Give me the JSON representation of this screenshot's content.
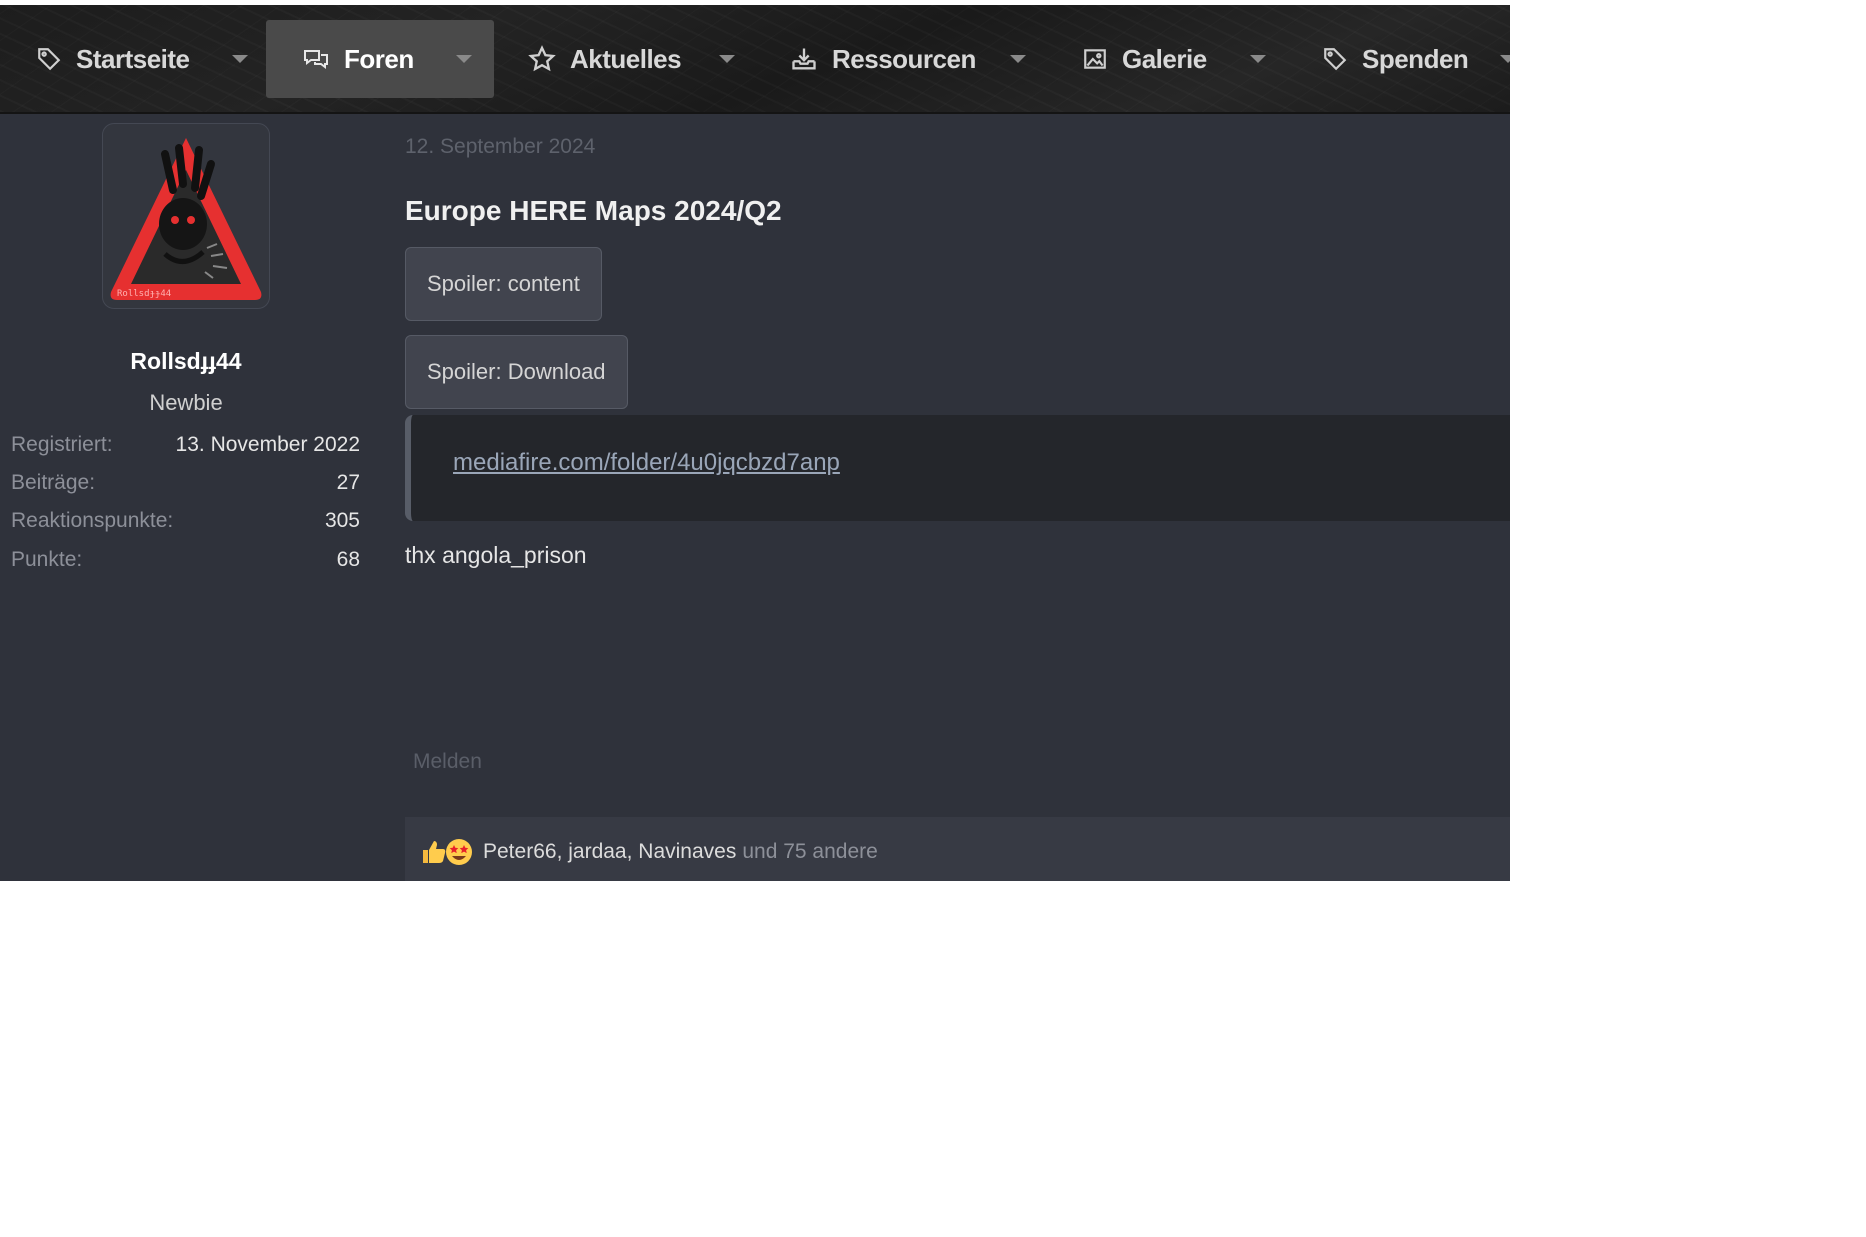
{
  "nav": {
    "items": [
      {
        "label": "Startseite",
        "icon": "tag-icon",
        "active": false
      },
      {
        "label": "Foren",
        "icon": "chat-bubbles-icon",
        "active": true
      },
      {
        "label": "Aktuelles",
        "icon": "star-icon",
        "active": false
      },
      {
        "label": "Ressourcen",
        "icon": "download-tray-icon",
        "active": false
      },
      {
        "label": "Galerie",
        "icon": "image-icon",
        "active": false
      },
      {
        "label": "Spenden",
        "icon": "tag-icon",
        "active": false
      }
    ]
  },
  "user": {
    "avatar_text": "Rollsdɟɟ44",
    "name": "Rollsdɟɟ44",
    "rank": "Newbie",
    "stats": [
      {
        "key": "Registriert:",
        "value": "13. November 2022"
      },
      {
        "key": "Beiträge:",
        "value": "27"
      },
      {
        "key": "Reaktionspunkte:",
        "value": "305"
      },
      {
        "key": "Punkte:",
        "value": "68"
      }
    ]
  },
  "post": {
    "date": "12. September 2024",
    "title": "Europe HERE Maps 2024/Q2",
    "spoiler_content": "Spoiler: content",
    "spoiler_download": "Spoiler: Download",
    "link": "mediafire.com/folder/4u0jqcbzd7anp",
    "thanks": "thx angola_prison",
    "report": "Melden"
  },
  "reactions": {
    "icons": [
      "thumbs-up-icon",
      "star-eyes-icon"
    ],
    "users": [
      "Peter66",
      "jardaa",
      "Navinaves"
    ],
    "others": "und 75 andere"
  },
  "colors": {
    "background": "#2f323b",
    "nav_active": "#4a4a4a",
    "avatar_red": "#e63030"
  }
}
